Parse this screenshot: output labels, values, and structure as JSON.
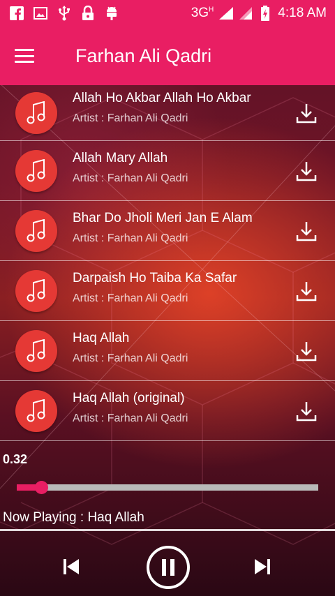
{
  "status_bar": {
    "left_icons": [
      "facebook-icon",
      "gallery-icon",
      "usb-icon",
      "lock-icon",
      "android-icon"
    ],
    "network": "3G",
    "network_sup": "H",
    "time": "4:18 AM"
  },
  "app_bar": {
    "title": "Farhan Ali Qadri",
    "menu_icon": "hamburger-menu-icon"
  },
  "songs": [
    {
      "title": "Allah Ho Akbar Allah Ho Akbar",
      "artist": "Artist : Farhan Ali Qadri"
    },
    {
      "title": "Allah Mary Allah",
      "artist": "Artist : Farhan Ali Qadri"
    },
    {
      "title": "Bhar Do Jholi Meri Jan E Alam",
      "artist": "Artist : Farhan Ali Qadri"
    },
    {
      "title": "Darpaish Ho Taiba Ka Safar",
      "artist": "Artist : Farhan Ali Qadri"
    },
    {
      "title": "Haq Allah",
      "artist": "Artist : Farhan Ali Qadri"
    },
    {
      "title": "Haq Allah (original)",
      "artist": "Artist : Farhan Ali Qadri"
    }
  ],
  "player": {
    "elapsed": "0.32",
    "progress_fraction": 0.08,
    "now_playing": "Now Playing : Haq Allah",
    "state": "playing"
  },
  "colors": {
    "accent": "#e91e63",
    "note_circle": "#e53935",
    "seek_track": "#b9b9b9"
  }
}
